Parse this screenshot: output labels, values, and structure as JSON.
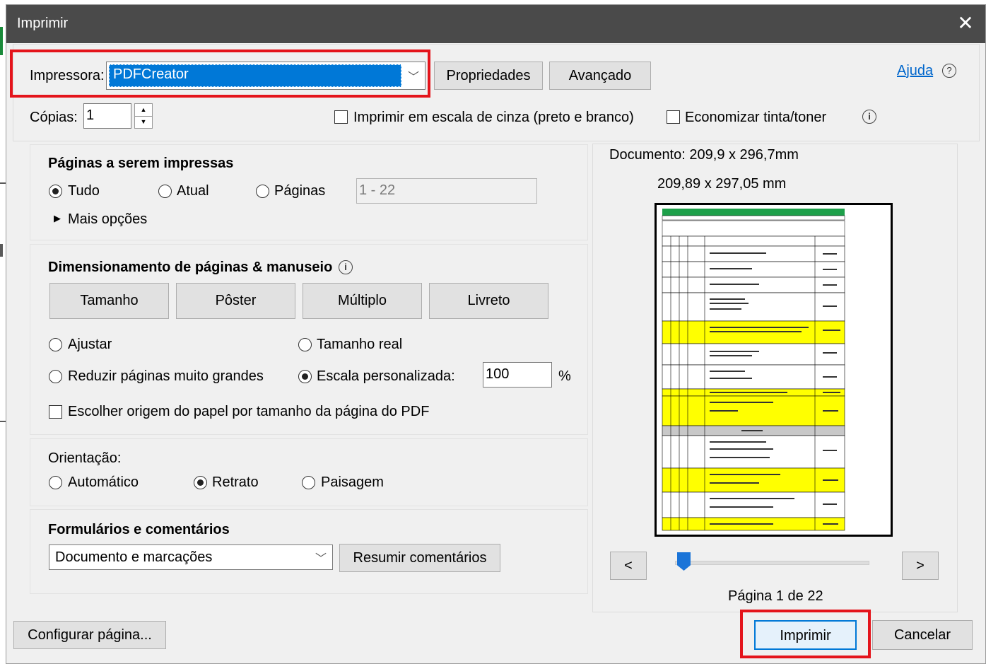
{
  "window": {
    "title": "Imprimir",
    "close_glyph": "✕"
  },
  "printer": {
    "label": "Impressora:",
    "selected": "PDFCreator",
    "properties_button": "Propriedades",
    "advanced_button": "Avançado",
    "help_link": "Ajuda",
    "help_icon": "question-circle-icon"
  },
  "copies": {
    "label": "Cópias:",
    "value": "1",
    "grayscale_label": "Imprimir em escala de cinza (preto e branco)",
    "grayscale_checked": false,
    "save_ink_label": "Economizar tinta/toner",
    "save_ink_checked": false
  },
  "pages_section": {
    "heading": "Páginas a serem impressas",
    "options": [
      "Tudo",
      "Atual",
      "Páginas"
    ],
    "selected": "Tudo",
    "range_placeholder": "1 - 22",
    "more_options": "Mais opções"
  },
  "sizing_section": {
    "heading": "Dimensionamento de páginas & manuseio",
    "tabs": [
      "Tamanho",
      "Pôster",
      "Múltiplo",
      "Livreto"
    ],
    "fit": "Ajustar",
    "actual_size": "Tamanho real",
    "shrink": "Reduzir páginas muito grandes",
    "custom_scale": "Escala personalizada:",
    "scale_value": "100",
    "scale_unit": "%",
    "selected": "Escala personalizada:",
    "paper_source": "Escolher origem do papel por tamanho da página do PDF",
    "paper_source_checked": false
  },
  "orientation_section": {
    "label": "Orientação:",
    "options": [
      "Automático",
      "Retrato",
      "Paisagem"
    ],
    "selected": "Retrato"
  },
  "forms_section": {
    "heading": "Formulários e comentários",
    "selected": "Documento e marcações",
    "summarize_button": "Resumir comentários"
  },
  "preview": {
    "document_size": "Documento: 209,9 x 296,7mm",
    "paper_size": "209,89 x 297,05 mm",
    "prev_button": "<",
    "next_button": ">",
    "page_indicator": "Página 1 de 22",
    "current_page": 1,
    "total_pages": 22
  },
  "footer": {
    "page_setup_button": "Configurar página...",
    "print_button": "Imprimir",
    "cancel_button": "Cancelar"
  },
  "colors": {
    "titlebar": "#4a4a4a",
    "dialog_bg": "#f0f0f0",
    "highlight_red": "#e4141b",
    "select_blue": "#0078d7",
    "link_blue": "#0066cc",
    "preview_yellow": "#ffff00",
    "preview_green": "#1ea04a"
  }
}
